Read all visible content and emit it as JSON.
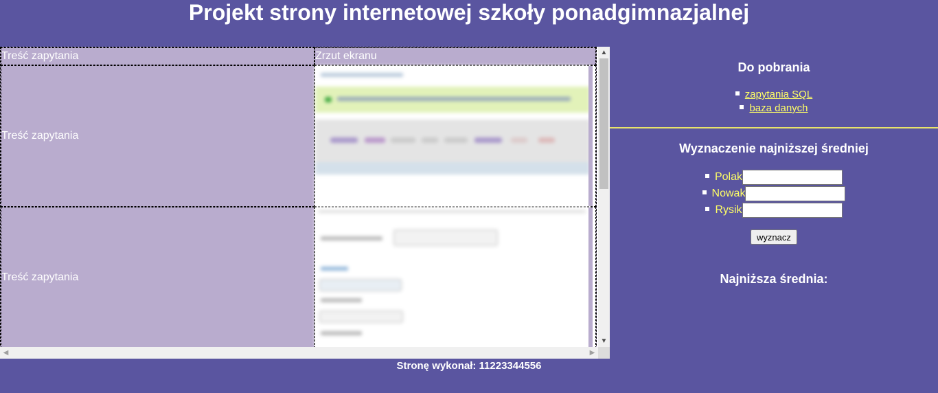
{
  "header": {
    "title": "Projekt strony internetowej szkoły ponadgimnazjalnej"
  },
  "queries_table": {
    "columns": [
      "Treść zapytania",
      "Zrzut ekranu"
    ],
    "rows": [
      {
        "query": "Treść zapytania"
      },
      {
        "query": "Treść zapytania"
      }
    ]
  },
  "downloads": {
    "title": "Do pobrania",
    "links": [
      "zapytania SQL",
      "baza danych"
    ]
  },
  "calculator": {
    "title": "Wyznaczenie najniższej średniej",
    "fields": [
      {
        "label": "Polak",
        "value": ""
      },
      {
        "label": "Nowak",
        "value": ""
      },
      {
        "label": "Rysik",
        "value": ""
      }
    ],
    "button_label": "wyznacz",
    "result_label": "Najniższa średnia:"
  },
  "footer": {
    "text": "Stronę wykonał: 11223344556"
  },
  "colors": {
    "page_background": "#5a55a0",
    "table_background": "#b9acce",
    "link": "#ffff66",
    "divider": "#e8e36a"
  },
  "icons": {
    "scroll_up": "▲",
    "scroll_down": "▼",
    "scroll_left": "◀",
    "scroll_right": "▶"
  }
}
